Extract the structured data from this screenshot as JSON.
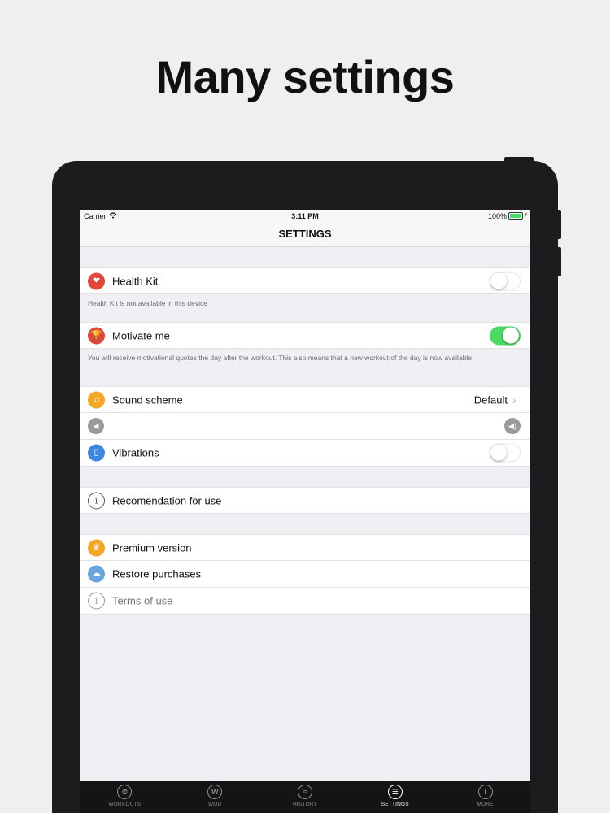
{
  "headline": "Many settings",
  "status_bar": {
    "carrier": "Carrier",
    "time": "3:11 PM",
    "battery": "100%"
  },
  "nav": {
    "title": "SETTINGS"
  },
  "settings": {
    "health_kit": {
      "label": "Health Kit",
      "icon": "health-kit-icon",
      "enabled": false
    },
    "health_kit_note": "Health Kit is not available in this device",
    "motivate_me": {
      "label": "Motivate me",
      "icon": "trophy-icon",
      "enabled": true
    },
    "motivate_note": "You will receive motivational quotes the day after the workout. This also means that a new workout of the day is now available",
    "sound_scheme": {
      "label": "Sound scheme",
      "value": "Default",
      "icon": "music-note-icon"
    },
    "volume": {
      "min_icon": "speaker-low-icon",
      "max_icon": "speaker-high-icon"
    },
    "vibrations": {
      "label": "Vibrations",
      "icon": "phone-vibrate-icon",
      "enabled": false
    },
    "recommendation": {
      "label": "Recomendation for use",
      "icon": "info-icon"
    },
    "premium": {
      "label": "Premium version",
      "icon": "crown-icon"
    },
    "restore": {
      "label": "Restore purchases",
      "icon": "cloud-icon"
    },
    "terms": {
      "label": "Terms of use",
      "icon": "info-icon"
    }
  },
  "tabs": [
    {
      "label": "WORKOUTS",
      "icon": "stopwatch-icon",
      "active": false
    },
    {
      "label": "WOD",
      "icon": "w-circle-icon",
      "active": false
    },
    {
      "label": "HISTORY",
      "icon": "list-icon",
      "active": false
    },
    {
      "label": "SETTINGS",
      "icon": "sliders-icon",
      "active": true
    },
    {
      "label": "MORE",
      "icon": "info-icon",
      "active": false
    }
  ],
  "colors": {
    "toggle_on": "#4cd964",
    "red": "#e0463a",
    "orange": "#f5a623",
    "blue": "#3e86e6"
  }
}
